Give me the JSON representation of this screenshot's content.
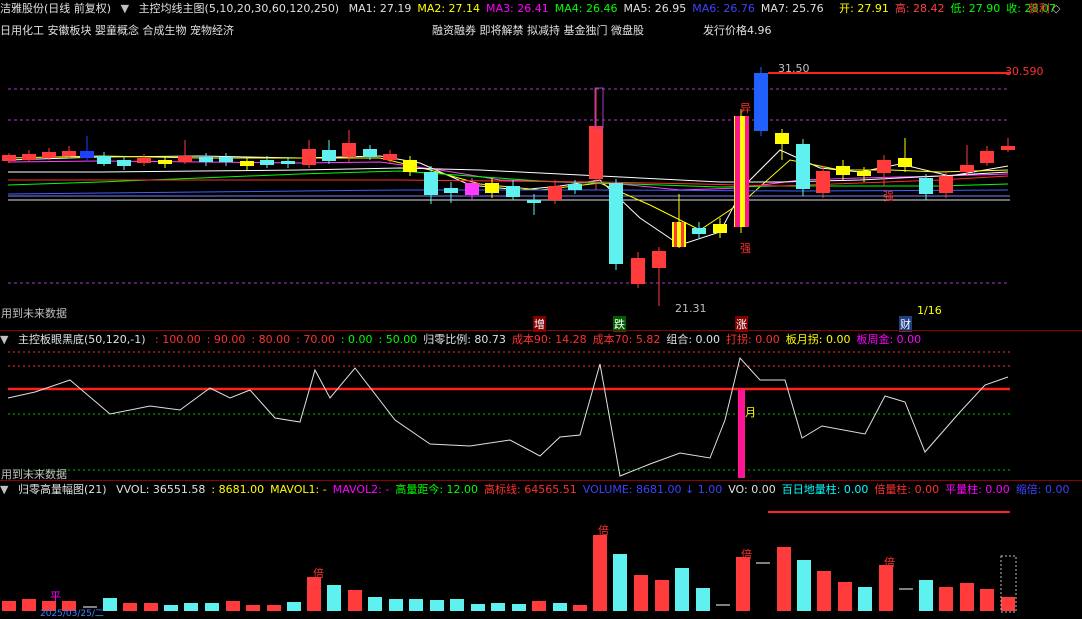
{
  "main": {
    "title": "洁雅股份(日线 前复权)",
    "indicator": "主控均线主图(5,10,20,30,60,120,250)",
    "ma": [
      {
        "label": "MA1:",
        "value": "27.19",
        "color": "#e0e0e0"
      },
      {
        "label": "MA2:",
        "value": "27.14",
        "color": "#ffff00"
      },
      {
        "label": "MA3:",
        "value": "26.41",
        "color": "#ff00ff"
      },
      {
        "label": "MA4:",
        "value": "26.46",
        "color": "#00ff00"
      },
      {
        "label": "MA5:",
        "value": "26.95",
        "color": "#e0e0e0"
      },
      {
        "label": "MA6:",
        "value": "26.76",
        "color": "#4040ff"
      },
      {
        "label": "MA7:",
        "value": "25.76",
        "color": "#e0e0e0"
      }
    ],
    "quote": [
      {
        "label": "开:",
        "value": "27.91",
        "color": "#ffff00"
      },
      {
        "label": "高:",
        "value": "28.42",
        "color": "#ff4040"
      },
      {
        "label": "低:",
        "value": "27.90",
        "color": "#00ff00"
      },
      {
        "label": "收:",
        "value": "28.07",
        "color": "#00ff00"
      }
    ],
    "profit_label": "获利",
    "concepts_left": "日用化工  安徽板块  婴童概念 合成生物 宠物经济",
    "concepts_mid": "融资融券 即将解禁 拟减持 基金独门 微盘股",
    "issue_price": "发行价格4.96",
    "price_high": "31.50",
    "price_low": "21.31",
    "price_right": "30.590",
    "future_note": "用到未来数据",
    "markers": {
      "yi": "异",
      "qiang1": "强",
      "qiang2": "强",
      "zeng": "增",
      "die": "跌",
      "zhang": "涨",
      "cai": "财"
    },
    "date_marker": "1/16"
  },
  "panel2": {
    "title": "主控板眼黑底(50,120,-1)",
    "items": [
      {
        "text": ": 100.00",
        "color": "#ff3030"
      },
      {
        "text": ": 90.00",
        "color": "#ff3030"
      },
      {
        "text": ": 80.00",
        "color": "#ff3030"
      },
      {
        "text": ": 70.00",
        "color": "#ff3030"
      },
      {
        "text": ": 0.00",
        "color": "#00ff00"
      },
      {
        "text": ": 50.00",
        "color": "#00ff00"
      },
      {
        "text": "归零比例: 80.73",
        "color": "#e0e0e0"
      },
      {
        "text": "成本90: 14.28",
        "color": "#ff3030"
      },
      {
        "text": "成本70: 5.82",
        "color": "#ff3030"
      },
      {
        "text": "组合: 0.00",
        "color": "#e0e0e0"
      },
      {
        "text": "打拐: 0.00",
        "color": "#ff3030"
      },
      {
        "text": "板月拐: 0.00",
        "color": "#ffff00"
      },
      {
        "text": "板周金: 0.00",
        "color": "#ff00ff"
      }
    ],
    "future_note": "用到未来数据",
    "month_marker": "月"
  },
  "panel3": {
    "title": "归零高量幅图(21)",
    "items": [
      {
        "text": "VVOL: 36551.58",
        "color": "#e0e0e0"
      },
      {
        "text": ": 8681.00",
        "color": "#ffff00"
      },
      {
        "text": "MAVOL1: -",
        "color": "#ffff00"
      },
      {
        "text": "MAVOL2: -",
        "color": "#ff00ff"
      },
      {
        "text": "高量距今: 12.00",
        "color": "#00ff00"
      },
      {
        "text": "高标线: 64565.51",
        "color": "#ff3030"
      },
      {
        "text": "VOLUME: 8681.00 ↓ 1.00",
        "color": "#4040ff"
      },
      {
        "text": "VO: 0.00",
        "color": "#e0e0e0"
      },
      {
        "text": "百日地量柱: 0.00",
        "color": "#00ffff"
      },
      {
        "text": "倍量柱: 0.00",
        "color": "#ff3030"
      },
      {
        "text": "平量柱: 0.00",
        "color": "#ff00ff"
      },
      {
        "text": "缩倍: 0.00",
        "color": "#4040ff"
      }
    ],
    "bei": "倍",
    "ping": "平",
    "bottom_date": "2025/03/25/二"
  }
}
